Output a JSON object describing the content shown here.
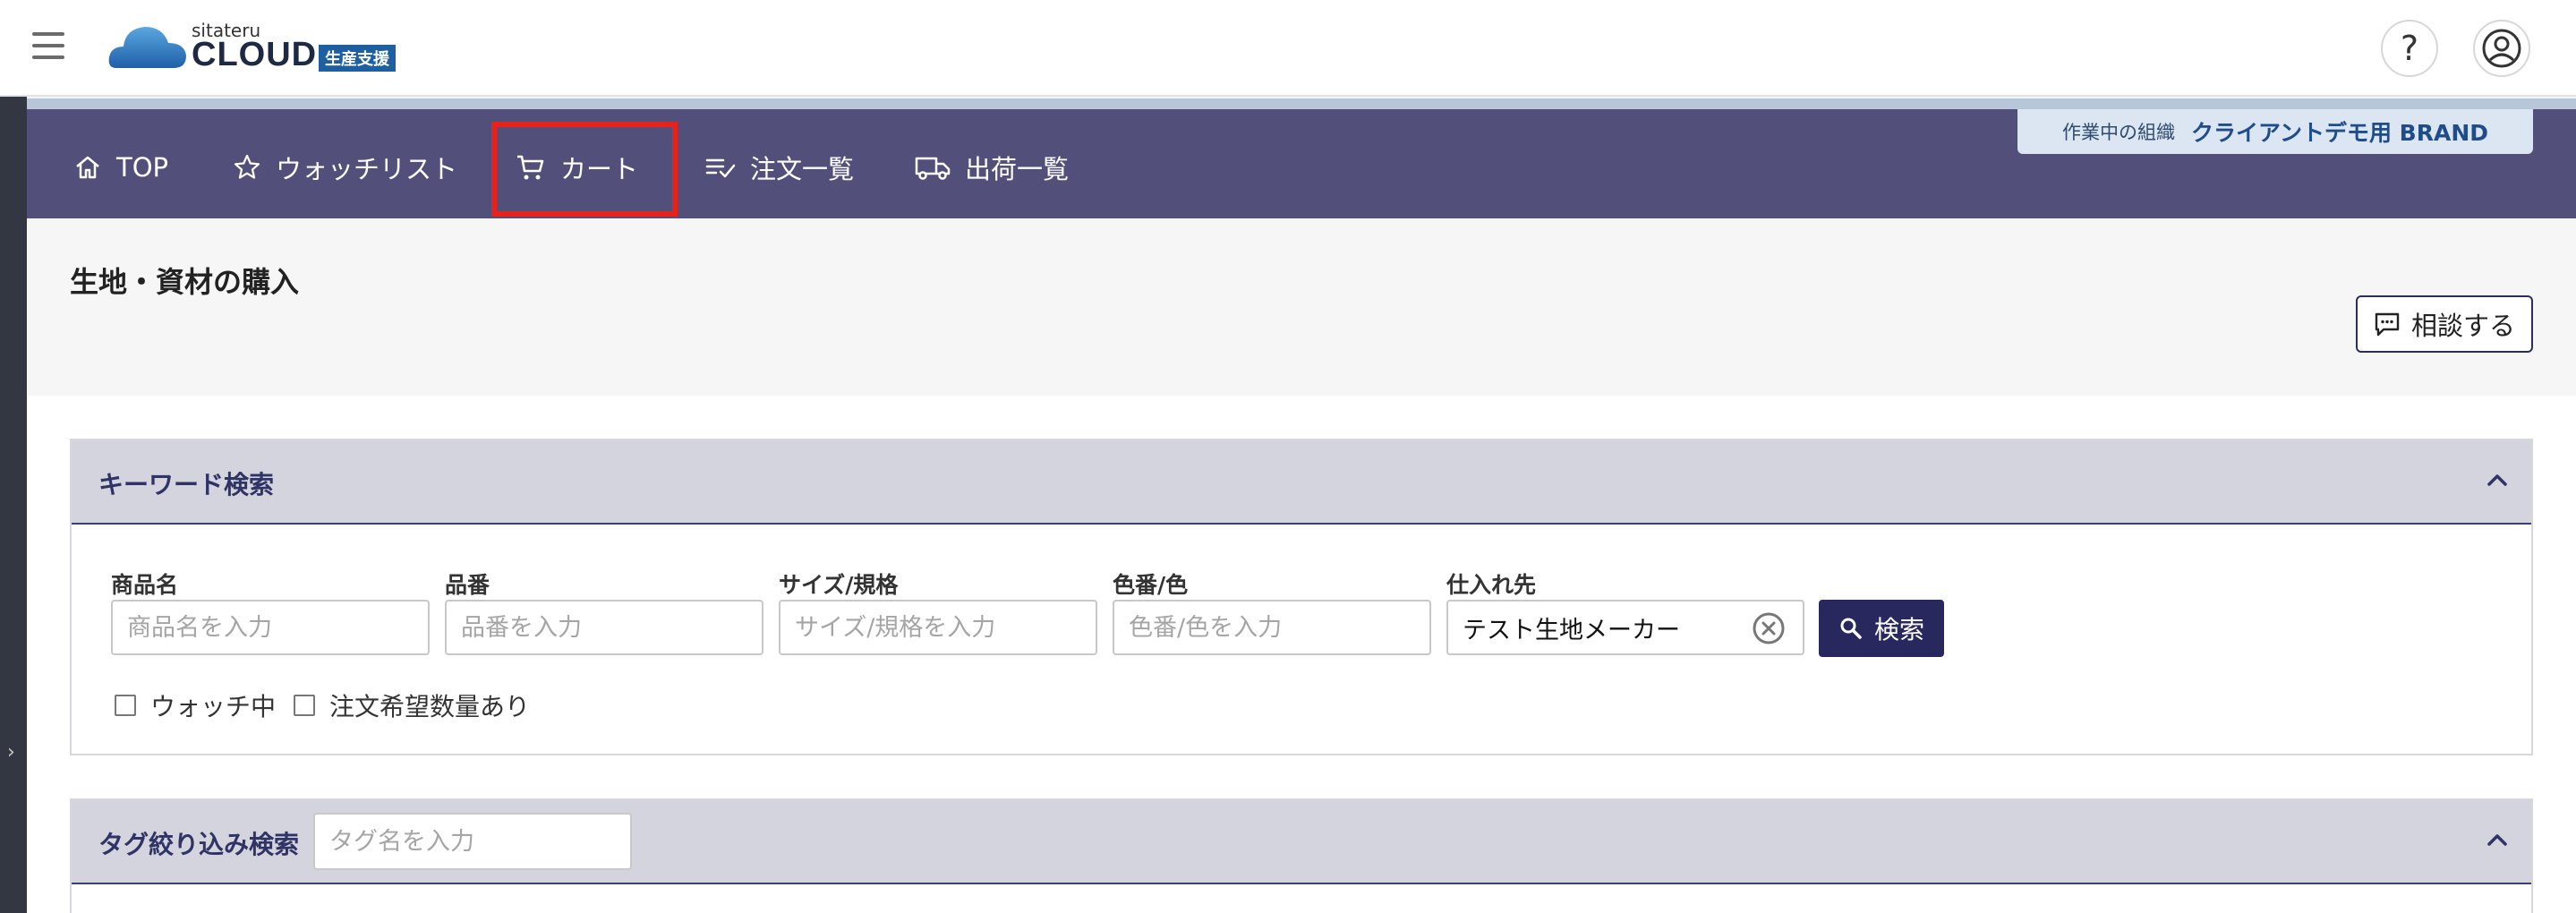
{
  "app": {
    "logo_sub": "sitateru",
    "logo_main": "CLOUD",
    "logo_tag": "生産支援"
  },
  "header": {
    "help_label": "?"
  },
  "org": {
    "label": "作業中の組織",
    "value": "クライアントデモ用 BRAND"
  },
  "nav": {
    "items": [
      {
        "label": "TOP",
        "icon": "home-icon"
      },
      {
        "label": "ウォッチリスト",
        "icon": "star-icon"
      },
      {
        "label": "カート",
        "icon": "cart-icon"
      },
      {
        "label": "注文一覧",
        "icon": "checklist-icon"
      },
      {
        "label": "出荷一覧",
        "icon": "truck-icon"
      }
    ],
    "highlighted": "カート"
  },
  "page": {
    "title": "生地・資材の購入",
    "consult_button": "相談する"
  },
  "keyword_search": {
    "title": "キーワード検索",
    "fields": {
      "product_name": {
        "label": "商品名",
        "placeholder": "商品名を入力",
        "value": ""
      },
      "product_code": {
        "label": "品番",
        "placeholder": "品番を入力",
        "value": ""
      },
      "size": {
        "label": "サイズ/規格",
        "placeholder": "サイズ/規格を入力",
        "value": ""
      },
      "color": {
        "label": "色番/色",
        "placeholder": "色番/色を入力",
        "value": ""
      },
      "supplier": {
        "label": "仕入れ先",
        "placeholder": "",
        "value": "テスト生地メーカー"
      }
    },
    "search_button": "検索",
    "checkboxes": {
      "watching": {
        "label": "ウォッチ中",
        "checked": false
      },
      "has_order_qty": {
        "label": "注文希望数量あり",
        "checked": false
      }
    }
  },
  "tag_search": {
    "title": "タグ絞り込み検索",
    "placeholder": "タグ名を入力",
    "value": ""
  },
  "colors": {
    "nav_bg": "#52507a",
    "primary": "#28285f",
    "highlight": "#e8211a",
    "panel_head": "#d3d4dd"
  }
}
